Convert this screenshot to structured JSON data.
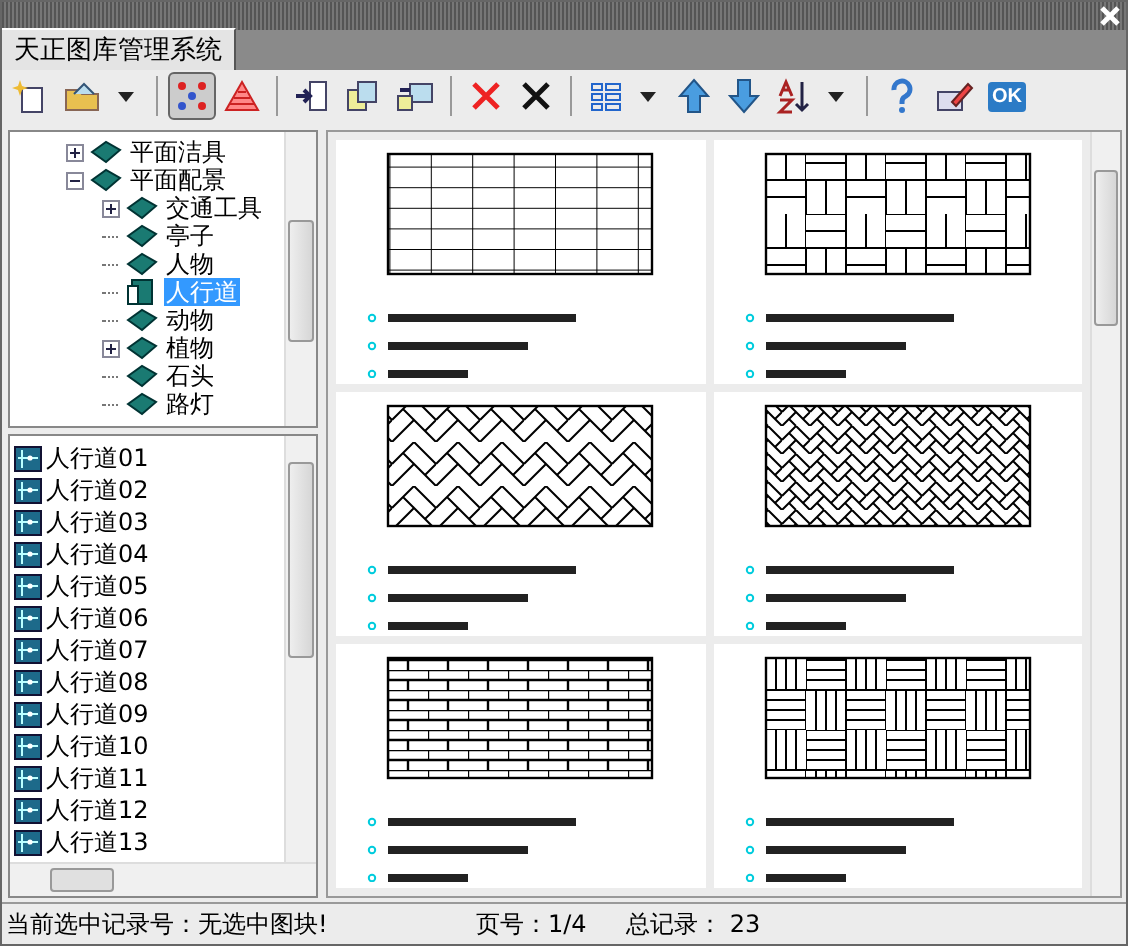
{
  "tab": {
    "label": "天正图库管理系统",
    "selected": true
  },
  "toolbar": [
    {
      "kind": "new",
      "pressed": false,
      "dropdown": false
    },
    {
      "kind": "open",
      "pressed": false,
      "dropdown": true
    },
    {
      "kind": "separator"
    },
    {
      "kind": "dots",
      "pressed": true,
      "dropdown": false
    },
    {
      "kind": "triangle",
      "pressed": false,
      "dropdown": false
    },
    {
      "kind": "separator"
    },
    {
      "kind": "import",
      "pressed": false,
      "dropdown": false
    },
    {
      "kind": "copy",
      "pressed": false,
      "dropdown": false
    },
    {
      "kind": "swap",
      "pressed": false,
      "dropdown": false
    },
    {
      "kind": "separator"
    },
    {
      "kind": "delete",
      "pressed": false,
      "dropdown": false
    },
    {
      "kind": "cross",
      "pressed": false,
      "dropdown": false
    },
    {
      "kind": "separator"
    },
    {
      "kind": "grid",
      "pressed": false,
      "dropdown": true
    },
    {
      "kind": "up",
      "pressed": false,
      "dropdown": false
    },
    {
      "kind": "down",
      "pressed": false,
      "dropdown": false
    },
    {
      "kind": "sort",
      "pressed": false,
      "dropdown": true
    },
    {
      "kind": "separator"
    },
    {
      "kind": "help",
      "pressed": false,
      "dropdown": false
    },
    {
      "kind": "edit",
      "pressed": false,
      "dropdown": false
    },
    {
      "kind": "ok",
      "pressed": false,
      "dropdown": false,
      "text": "OK"
    }
  ],
  "tree": [
    {
      "label": "平面洁具",
      "kind": "collapsed",
      "selected": false
    },
    {
      "label": "平面配景",
      "kind": "expanded",
      "selected": false,
      "children": [
        {
          "label": "交通工具",
          "kind": "collapsed",
          "selected": false
        },
        {
          "label": "亭子",
          "kind": "leaf",
          "selected": false
        },
        {
          "label": "人物",
          "kind": "leaf",
          "selected": false
        },
        {
          "label": "人行道",
          "kind": "leaf",
          "selected": true
        },
        {
          "label": "动物",
          "kind": "leaf",
          "selected": false
        },
        {
          "label": "植物",
          "kind": "collapsed",
          "selected": false
        },
        {
          "label": "石头",
          "kind": "leaf",
          "selected": false
        },
        {
          "label": "路灯",
          "kind": "leaf",
          "selected": false
        }
      ]
    }
  ],
  "list": [
    "人行道01",
    "人行道02",
    "人行道03",
    "人行道04",
    "人行道05",
    "人行道06",
    "人行道07",
    "人行道08",
    "人行道09",
    "人行道10",
    "人行道11",
    "人行道12",
    "人行道13"
  ],
  "thumbnails": [
    {
      "kind": "grid"
    },
    {
      "kind": "basket"
    },
    {
      "kind": "herringbone"
    },
    {
      "kind": "fine"
    },
    {
      "kind": "brick"
    },
    {
      "kind": "parquet"
    }
  ],
  "status_bar": {
    "record": "当前选中记录号：无选中图块!",
    "page": "页号：1/4",
    "total": "总记录：  23"
  }
}
